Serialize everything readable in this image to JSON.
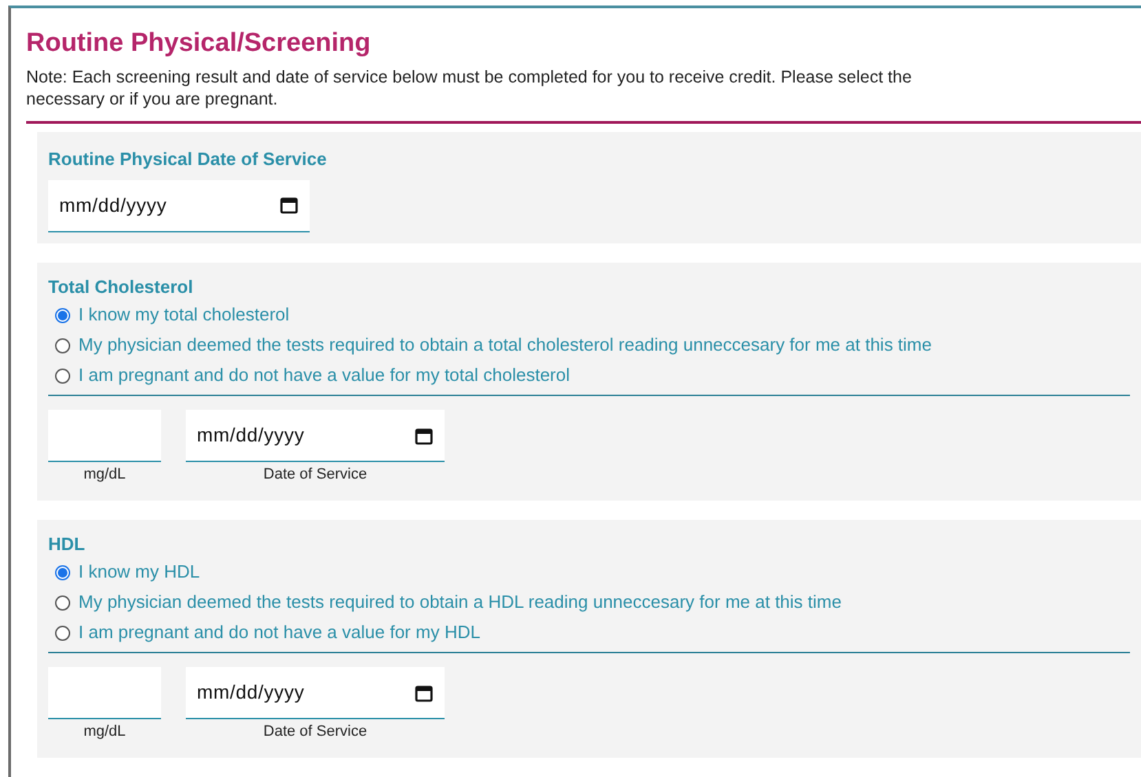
{
  "title": "Routine Physical/Screening",
  "note_lines": [
    "Note: Each screening result and date of service below must be completed for you to receive credit. Please select the",
    "necessary or if you are pregnant."
  ],
  "sections": [
    {
      "kind": "date",
      "label": "Routine Physical Date of Service",
      "date_placeholder": "mm/dd/yyyy"
    },
    {
      "kind": "screening",
      "label": "Total Cholesterol",
      "options": [
        {
          "label": "I know my total cholesterol",
          "selected": true
        },
        {
          "label": "My physician deemed the tests required to obtain a total cholesterol reading unneccesary for me at this time",
          "selected": false
        },
        {
          "label": "I am pregnant and do not have a value for my total cholesterol",
          "selected": false
        }
      ],
      "unit": "mg/dL",
      "date_placeholder": "mm/dd/yyyy",
      "date_caption": "Date of Service"
    },
    {
      "kind": "screening",
      "label": "HDL",
      "options": [
        {
          "label": "I know my HDL",
          "selected": true
        },
        {
          "label": "My physician deemed the tests required to obtain a HDL reading unneccesary for me at this time",
          "selected": false
        },
        {
          "label": "I am pregnant and do not have a value for my HDL",
          "selected": false
        }
      ],
      "unit": "mg/dL",
      "date_placeholder": "mm/dd/yyyy",
      "date_caption": "Date of Service"
    }
  ]
}
